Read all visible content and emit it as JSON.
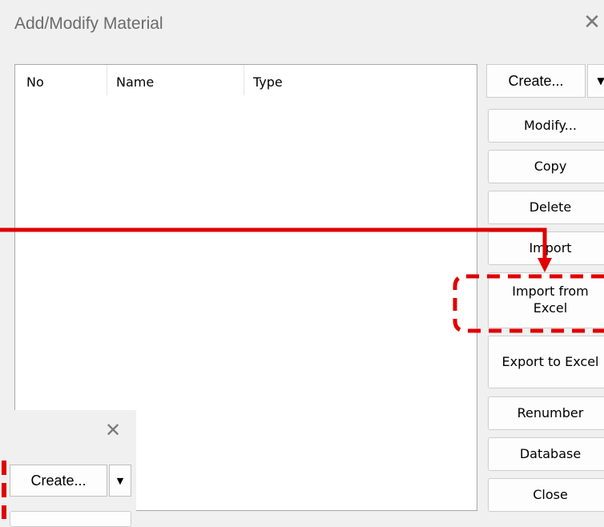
{
  "dialog": {
    "title": "Add/Modify Material",
    "close_glyph": "✕"
  },
  "list": {
    "columns": [
      "No",
      "Name",
      "Type"
    ],
    "rows": []
  },
  "buttons": {
    "create": "Create...",
    "create_dropdown_glyph": "▼",
    "modify": "Modify...",
    "copy": "Copy",
    "delete": "Delete",
    "import": "Import",
    "import_from_excel": "Import from\nExcel",
    "export_to_excel": "Export to Excel",
    "renumber": "Renumber",
    "database": "Database",
    "close": "Close"
  },
  "inset": {
    "close_glyph": "✕",
    "create": "Create...",
    "create_dropdown_glyph": "▼"
  },
  "annotation": {
    "arrow_color": "#e00000",
    "highlight_color": "#e00000",
    "highlight_target": "import_from_excel"
  },
  "icons": [
    "close-icon",
    "dropdown-arrow-icon"
  ]
}
